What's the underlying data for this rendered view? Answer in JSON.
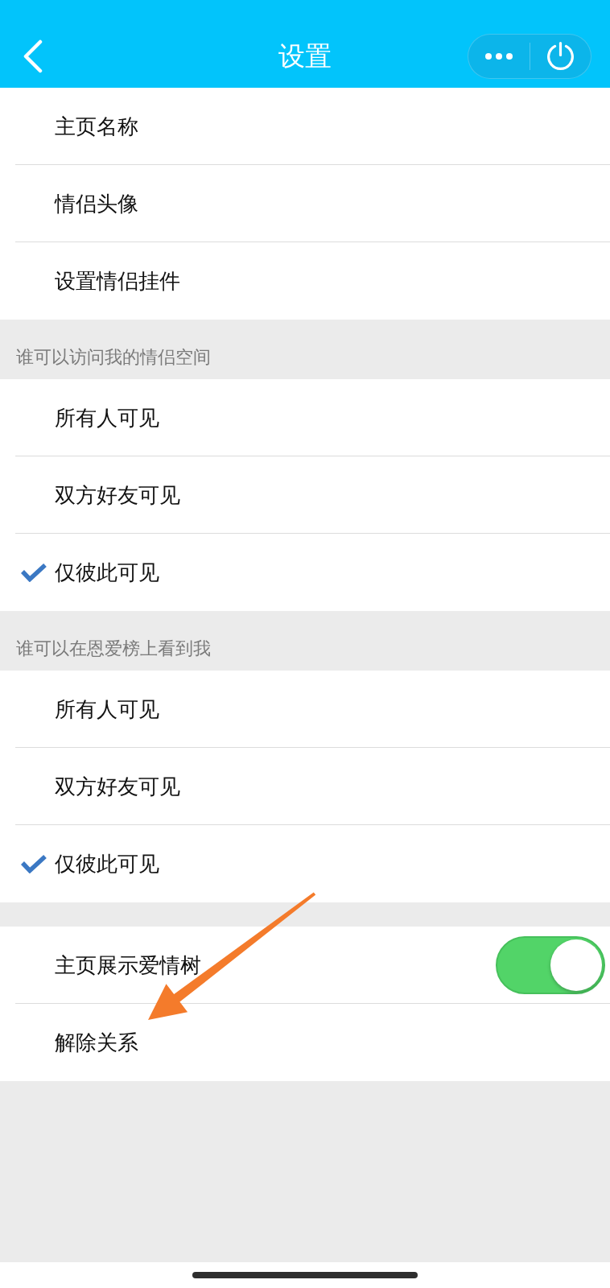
{
  "nav_bar": {
    "title": "设置"
  },
  "groups": [
    {
      "items": [
        {
          "kind": "link",
          "label": "主页名称"
        },
        {
          "kind": "link",
          "label": "情侣头像"
        },
        {
          "kind": "link",
          "label": "设置情侣挂件"
        }
      ]
    },
    {
      "title": "谁可以访问我的情侣空间",
      "items": [
        {
          "kind": "option",
          "label": "所有人可见",
          "selected": false
        },
        {
          "kind": "option",
          "label": "双方好友可见",
          "selected": false
        },
        {
          "kind": "option",
          "label": "仅彼此可见",
          "selected": true
        }
      ]
    },
    {
      "title": "谁可以在恩爱榜上看到我",
      "items": [
        {
          "kind": "option",
          "label": "所有人可见",
          "selected": false
        },
        {
          "kind": "option",
          "label": "双方好友可见",
          "selected": false
        },
        {
          "kind": "option",
          "label": "仅彼此可见",
          "selected": true
        }
      ]
    },
    {
      "items": [
        {
          "kind": "switch",
          "label": "主页展示爱情树",
          "on": true
        },
        {
          "kind": "link",
          "label": "解除关系"
        }
      ]
    }
  ]
}
